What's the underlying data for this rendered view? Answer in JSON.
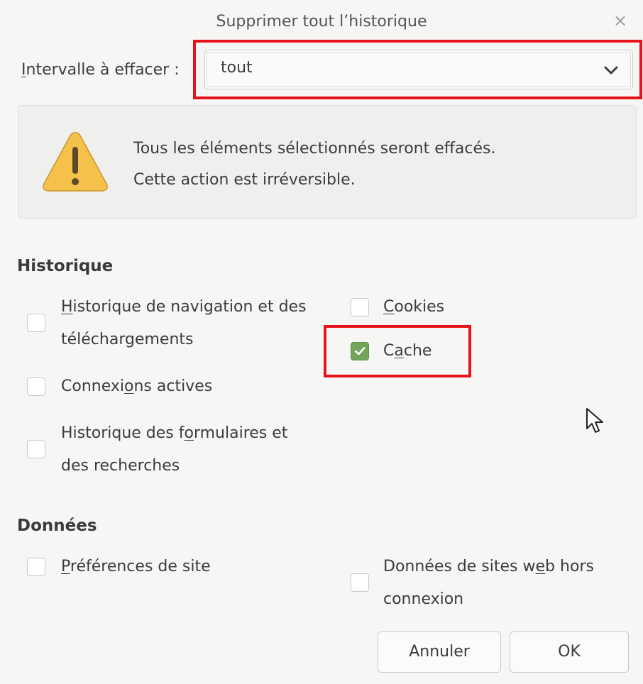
{
  "dialog": {
    "title": "Supprimer tout l’historique",
    "close_glyph": "×"
  },
  "range": {
    "label": "Intervalle à effacer :",
    "value": "tout"
  },
  "warning": {
    "line1": "Tous les éléments sélectionnés seront effacés.",
    "line2": "Cette action est irréversible."
  },
  "history": {
    "heading": "Historique",
    "items": [
      {
        "line1": "Historique de navigation et des",
        "line2": "téléchargements",
        "checked": false
      },
      {
        "label": "Cookies",
        "checked": false
      },
      {
        "label": "Cache",
        "checked": true
      },
      {
        "label": "Connexions actives",
        "checked": false
      },
      {
        "line1": "Historique des formulaires et",
        "line2": "des recherches",
        "checked": false
      }
    ]
  },
  "data_section": {
    "heading": "Données",
    "items": [
      {
        "label": "Préférences de site",
        "checked": false
      },
      {
        "line1": "Données de sites web hors",
        "line2": "connexion",
        "checked": false
      }
    ]
  },
  "buttons": {
    "cancel": "Annuler",
    "ok": "OK"
  },
  "colors": {
    "highlight": "#e8121a",
    "checkbox_checked": "#72a55a",
    "warning_icon": "#f5c14b"
  },
  "icons": {
    "warning": "warning-triangle-icon",
    "dropdown": "chevron-down-icon",
    "close": "close-icon",
    "cursor": "mouse-pointer-icon"
  }
}
